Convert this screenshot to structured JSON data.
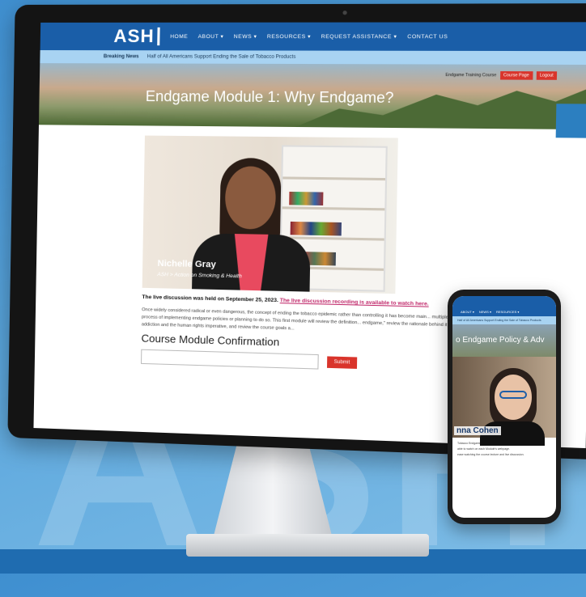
{
  "monitor_site": {
    "nav": {
      "logo": "ASH",
      "items": [
        "HOME",
        "ABOUT ▾",
        "NEWS ▾",
        "RESOURCES ▾",
        "REQUEST ASSISTANCE ▾",
        "CONTACT US"
      ]
    },
    "subnav": {
      "breaking_label": "Breaking News",
      "headline": "Half of All Americans Support Ending the Sale of Tobacco Products"
    },
    "hero": {
      "title": "Endgame Module 1: Why Endgame?",
      "course_label": "Endgame Training Course",
      "course_page_button": "Course Page",
      "logout_button": "Logout"
    },
    "video": {
      "name": "Nichelle Gray",
      "org": "ASH > Action on Smoking & Health"
    },
    "discussion": {
      "prefix": "The live discussion was held on September 25, 2023.",
      "link": "The live discussion recording is available to watch here."
    },
    "description": "Once widely considered radical or even dangerous, the concept of ending the tobacco epidemic rather than controlling it has become main... multiple jurisdictions are in the process of implementing endgame policies or planning to do so. This first module will review the definition... endgame,\" review the rationale behind it, touching specifically on addiction and the human rights imperative, and review the course goals a...",
    "confirmation": {
      "title": "Course Module Confirmation",
      "submit": "Submit"
    }
  },
  "phone_site": {
    "hero_title": "o Endgame Policy & Adv",
    "presenter_name": "nna Cohen",
    "text_lines": [
      "Tobacco Endgame Policy and Advocacy Training course and",
      "able to watch on each Module's webpage.",
      "ease watching the course lecture and live discussion."
    ]
  },
  "colors": {
    "brand_blue": "#1a5ea8",
    "light_blue": "#a8d3f2",
    "accent_red": "#d9342b",
    "link_pink": "#c0286a"
  }
}
